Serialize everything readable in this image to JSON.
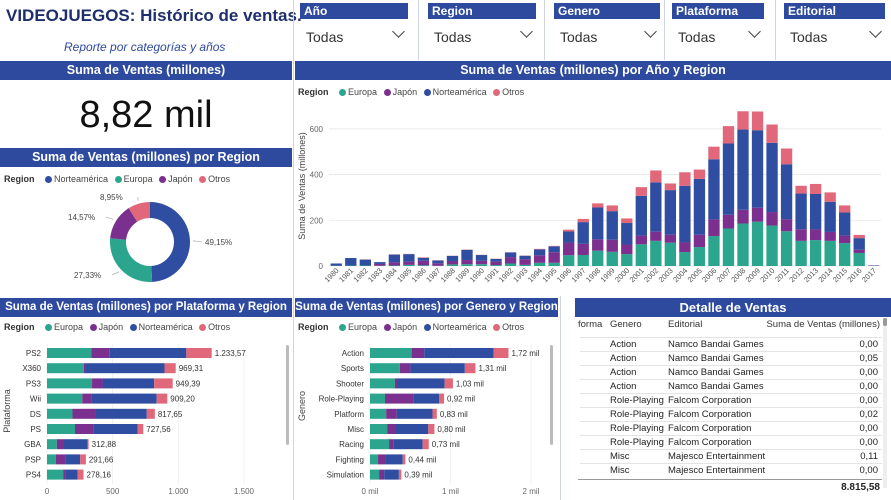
{
  "title": "VIDEOJUEGOS: Histórico de ventas.",
  "subtitle": "Reporte por categorías y años",
  "slicers": [
    {
      "label": "Año",
      "value": "Todas"
    },
    {
      "label": "Region",
      "value": "Todas"
    },
    {
      "label": "Genero",
      "value": "Todas"
    },
    {
      "label": "Plataforma",
      "value": "Todas"
    },
    {
      "label": "Editorial",
      "value": "Todas"
    }
  ],
  "kpi": {
    "title": "Suma de Ventas (millones)",
    "value": "8,82 mil"
  },
  "colors": {
    "header": "#2e4a9e",
    "europa": "#2ba58d",
    "japon": "#7b2f8e",
    "norteamerica": "#2f4ea1",
    "otros": "#e0687a"
  },
  "region_label": "Region",
  "chart_data": [
    {
      "type": "pie",
      "title": "Suma de Ventas (millones) por Region",
      "legend": [
        "Norteamérica",
        "Europa",
        "Japón",
        "Otros"
      ],
      "slices": [
        {
          "name": "Norteamérica",
          "value": 49.15,
          "label": "49,15%"
        },
        {
          "name": "Europa",
          "value": 27.33,
          "label": "27,33%"
        },
        {
          "name": "Japón",
          "value": 14.57,
          "label": "14,57%"
        },
        {
          "name": "Otros",
          "value": 8.95,
          "label": "8,95%"
        }
      ]
    },
    {
      "type": "bar",
      "stacked": true,
      "title": "Suma de Ventas (millones) por Año y Region",
      "legend": [
        "Europa",
        "Japón",
        "Norteamérica",
        "Otros"
      ],
      "ylabel": "Suma de Ventas (millones)",
      "ylim": [
        0,
        700
      ],
      "yticks": [
        "0",
        "200",
        "400",
        "600"
      ],
      "categories": [
        "1980",
        "1981",
        "1982",
        "1983",
        "1984",
        "1985",
        "1986",
        "1987",
        "1988",
        "1989",
        "1990",
        "1991",
        "1992",
        "1993",
        "1994",
        "1995",
        "1996",
        "1997",
        "1998",
        "1999",
        "2000",
        "2001",
        "2002",
        "2003",
        "2004",
        "2005",
        "2006",
        "2007",
        "2008",
        "2009",
        "2010",
        "2011",
        "2012",
        "2013",
        "2014",
        "2015",
        "2016",
        "2017"
      ],
      "series": [
        {
          "name": "Europa",
          "values": [
            1,
            2,
            2,
            1,
            2,
            5,
            3,
            1,
            7,
            8,
            8,
            4,
            11,
            5,
            14,
            14,
            47,
            48,
            67,
            62,
            52,
            95,
            110,
            102,
            61,
            83,
            131,
            164,
            186,
            194,
            177,
            152,
            110,
            113,
            110,
            100,
            57,
            1
          ]
        },
        {
          "name": "Japón",
          "values": [
            0,
            0,
            0,
            8,
            14,
            14,
            20,
            11,
            15,
            18,
            15,
            15,
            28,
            25,
            33,
            46,
            56,
            49,
            50,
            53,
            42,
            38,
            40,
            35,
            42,
            54,
            73,
            60,
            60,
            61,
            59,
            53,
            51,
            47,
            39,
            33,
            14,
            1
          ]
        },
        {
          "name": "Norteamérica",
          "values": [
            10,
            33,
            26,
            8,
            34,
            33,
            13,
            12,
            22,
            45,
            25,
            12,
            20,
            15,
            26,
            26,
            48,
            95,
            139,
            125,
            94,
            174,
            216,
            195,
            248,
            244,
            263,
            312,
            351,
            339,
            303,
            240,
            156,
            155,
            132,
            101,
            51,
            1
          ]
        },
        {
          "name": "Otros",
          "values": [
            0,
            0,
            1,
            0,
            1,
            1,
            2,
            1,
            1,
            1,
            1,
            1,
            1,
            1,
            2,
            2,
            8,
            14,
            18,
            25,
            20,
            38,
            52,
            29,
            59,
            41,
            55,
            76,
            80,
            82,
            80,
            69,
            34,
            44,
            41,
            31,
            14,
            0
          ]
        }
      ]
    },
    {
      "type": "bar",
      "orientation": "horizontal",
      "stacked": true,
      "title": "Suma de Ventas (millones) por Plataforma y Region",
      "legend": [
        "Europa",
        "Japón",
        "Norteamérica",
        "Otros"
      ],
      "ylabel": "Plataforma",
      "xlim": [
        0,
        1500
      ],
      "xticks": [
        "0",
        "500",
        "1.000",
        "1.500"
      ],
      "categories": [
        "PS2",
        "X360",
        "PS3",
        "Wii",
        "DS",
        "PS",
        "GBA",
        "PSP",
        "PS4"
      ],
      "totals_labels": [
        "1.233,57",
        "969,31",
        "949,39",
        "909,20",
        "817,65",
        "727,56",
        "312,88",
        "291,66",
        "278,16"
      ],
      "series": [
        {
          "name": "Europa",
          "values": [
            339,
            280,
            343,
            269,
            194,
            213,
            75,
            68,
            123
          ]
        },
        {
          "name": "Japón",
          "values": [
            139,
            13,
            80,
            69,
            175,
            140,
            47,
            76,
            15
          ]
        },
        {
          "name": "Norteamérica",
          "values": [
            583,
            602,
            393,
            497,
            391,
            336,
            187,
            109,
            96
          ]
        },
        {
          "name": "Otros",
          "values": [
            193,
            85,
            141,
            81,
            61,
            44,
            8,
            43,
            44
          ]
        }
      ]
    },
    {
      "type": "bar",
      "orientation": "horizontal",
      "stacked": true,
      "title": "Suma de Ventas (millones) por Genero y Region",
      "legend": [
        "Europa",
        "Japón",
        "Norteamérica",
        "Otros"
      ],
      "ylabel": "Genero",
      "xlim": [
        0,
        2000
      ],
      "xticks": [
        "0 mil",
        "1 mil",
        "2 mil"
      ],
      "categories": [
        "Action",
        "Sports",
        "Shooter",
        "Role-Playing",
        "Platform",
        "Misc",
        "Racing",
        "Fighting",
        "Simulation"
      ],
      "totals_labels": [
        "1,72 mil",
        "1,31 mil",
        "1,03 mil",
        "0,92 mil",
        "0,83 mil",
        "0,80 mil",
        "0,73 mil",
        "0,44 mil",
        "0,39 mil"
      ],
      "series": [
        {
          "name": "Europa",
          "values": [
            517,
            370,
            310,
            186,
            201,
            213,
            237,
            100,
            113
          ]
        },
        {
          "name": "Japón",
          "values": [
            156,
            132,
            38,
            350,
            130,
            104,
            57,
            87,
            63
          ]
        },
        {
          "name": "Norteamérica",
          "values": [
            864,
            676,
            579,
            325,
            445,
            407,
            360,
            220,
            183
          ]
        },
        {
          "name": "Otros",
          "values": [
            183,
            132,
            103,
            59,
            54,
            76,
            76,
            33,
            31
          ]
        }
      ]
    }
  ],
  "table": {
    "title": "Detalle de Ventas",
    "columns": [
      "forma",
      "Genero",
      "Editorial",
      "Suma de Ventas (millones)"
    ],
    "rows": [
      [
        "",
        "Action",
        "Namco Bandai Games",
        "0,00"
      ],
      [
        "",
        "Action",
        "Namco Bandai Games",
        "0,05"
      ],
      [
        "",
        "Action",
        "Namco Bandai Games",
        "0,00"
      ],
      [
        "",
        "Action",
        "Namco Bandai Games",
        "0,00"
      ],
      [
        "",
        "Role-Playing",
        "Falcom Corporation",
        "0,00"
      ],
      [
        "",
        "Role-Playing",
        "Falcom Corporation",
        "0,02"
      ],
      [
        "",
        "Role-Playing",
        "Falcom Corporation",
        "0,00"
      ],
      [
        "",
        "Role-Playing",
        "Falcom Corporation",
        "0,00"
      ],
      [
        "",
        "Misc",
        "Majesco Entertainment",
        "0,11"
      ],
      [
        "",
        "Misc",
        "Majesco Entertainment",
        "0,00"
      ]
    ],
    "total": "8.815,58"
  }
}
